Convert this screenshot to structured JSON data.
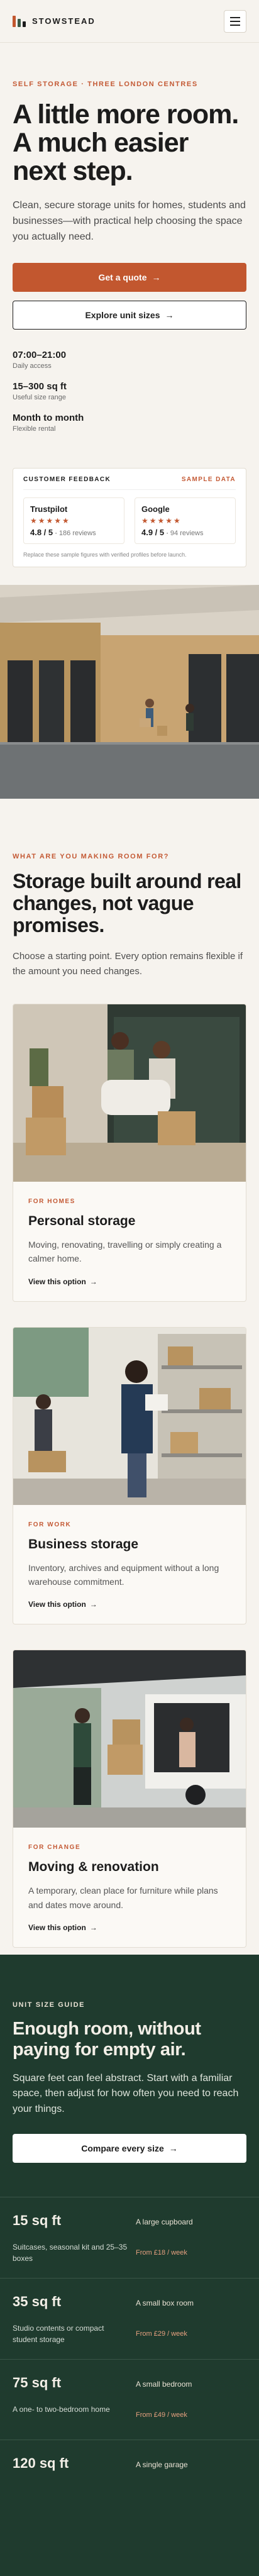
{
  "brand": {
    "name": "STOWSTEAD",
    "logo_colors": [
      "#c2572f",
      "#3b5a47",
      "#1c1c1c"
    ]
  },
  "header": {
    "menu_icon": "hamburger-icon"
  },
  "hero": {
    "eyebrow": "SELF STORAGE · THREE LONDON CENTRES",
    "title": "A little more room. A much easier next step.",
    "subtitle": "Clean, secure storage units for homes, students and businesses—with practical help choosing the space you actually need.",
    "primary_cta": "Get a quote",
    "primary_icon": "arrow-right-icon",
    "secondary_cta": "Explore unit sizes",
    "stats": [
      {
        "value": "07:00–21:00",
        "label": "Daily access"
      },
      {
        "value": "15–300 sq ft",
        "label": "Useful size range"
      },
      {
        "value": "Month to month",
        "label": "Flexible rental"
      }
    ]
  },
  "feedback": {
    "title": "CUSTOMER FEEDBACK",
    "tag": "SAMPLE DATA",
    "sources": [
      {
        "name": "Trustpilot",
        "stars": "★★★★★",
        "score": "4.8 / 5",
        "reviews": "186 reviews"
      },
      {
        "name": "Google",
        "stars": "★★★★★",
        "score": "4.9 / 5",
        "reviews": "94 reviews"
      }
    ],
    "note": "Replace these sample figures with verified profiles before launch."
  },
  "needs": {
    "eyebrow": "WHAT ARE YOU MAKING ROOM FOR?",
    "title": "Storage built around real changes, not vague promises.",
    "subtitle": "Choose a starting point. Every option remains flexible if the amount you need changes.",
    "cards": [
      {
        "eyebrow": "FOR HOMES",
        "title": "Personal storage",
        "text": "Moving, renovating, travelling or simply creating a calmer home.",
        "link": "View this option"
      },
      {
        "eyebrow": "FOR WORK",
        "title": "Business storage",
        "text": "Inventory, archives and equipment without a long warehouse commitment.",
        "link": "View this option"
      },
      {
        "eyebrow": "FOR CHANGE",
        "title": "Moving & renovation",
        "text": "A temporary, clean place for furniture while plans and dates move around.",
        "link": "View this option"
      }
    ]
  },
  "sizes": {
    "eyebrow": "UNIT SIZE GUIDE",
    "title": "Enough room, without paying for empty air.",
    "subtitle": "Square feet can feel abstract. Start with a familiar space, then adjust for how often you need to reach your things.",
    "cta": "Compare every size",
    "rows": [
      {
        "size": "15 sq ft",
        "desc": "Suitcases, seasonal kit and 25–35 boxes",
        "compare": "A large cupboard",
        "price": "From £18 / week"
      },
      {
        "size": "35 sq ft",
        "desc": "Studio contents or compact student storage",
        "compare": "A small box room",
        "price": "From £29 / week"
      },
      {
        "size": "75 sq ft",
        "desc": "A one- to two-bedroom home",
        "compare": "A small bedroom",
        "price": "From £49 / week"
      },
      {
        "size": "120 sq ft",
        "desc": "",
        "compare": "A single garage",
        "price": ""
      }
    ]
  }
}
